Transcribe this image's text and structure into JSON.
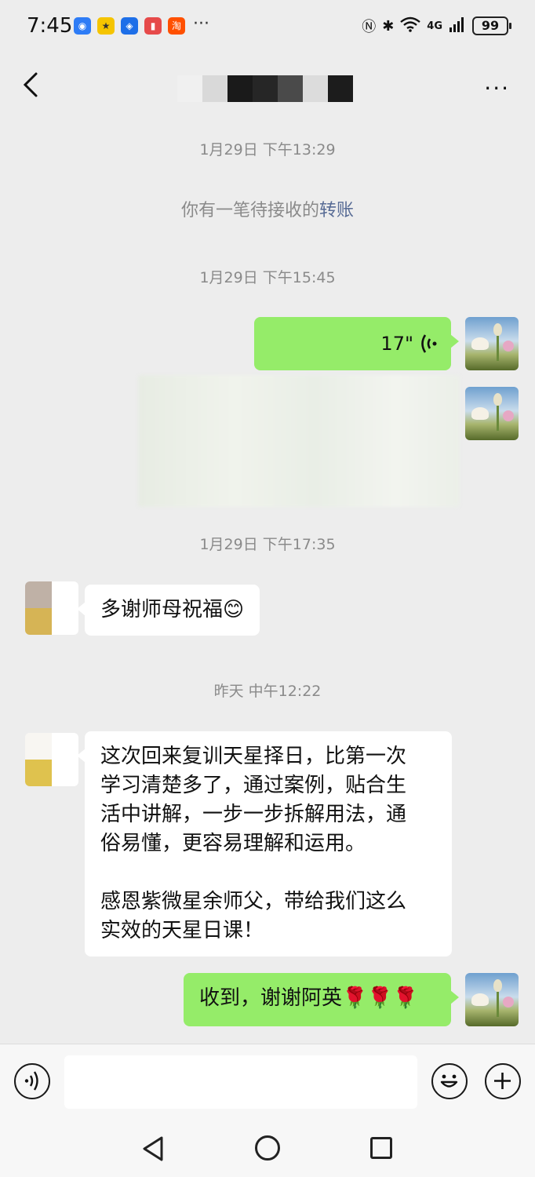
{
  "status_bar": {
    "time": "7:45",
    "more": "···",
    "network": "4G",
    "signal_small": "6",
    "battery": "99"
  },
  "header": {
    "back_icon": "chevron-left-icon",
    "more_icon": "more-dots-icon",
    "more": "···"
  },
  "messages": {
    "ts1": "1月29日 下午13:29",
    "sys_prefix": "你有一笔待接收的",
    "sys_link": "转账",
    "ts2": "1月29日 下午15:45",
    "voice_duration": "17\"",
    "ts3": "1月29日 下午17:35",
    "msg_thanks": "多谢师母祝福😊",
    "ts4": "昨天 中午12:22",
    "msg_long": "这次回来复训天星择日，比第一次\n学习清楚多了，通过案例，贴合生\n活中讲解，一步一步拆解用法，通\n俗易懂，更容易理解和运用。\n\n感恩紫微星余师父，带给我们这么\n实效的天星日课！",
    "msg_reply": "收到，谢谢阿英🌹🌹🌹"
  },
  "input_bar": {
    "voice_icon": "voice-input-icon",
    "emoji_icon": "emoji-icon",
    "plus_icon": "plus-icon",
    "placeholder": ""
  },
  "colors": {
    "bubble_green": "#95ec69",
    "bubble_white": "#ffffff",
    "background": "#ededed",
    "link": "#576b95"
  }
}
